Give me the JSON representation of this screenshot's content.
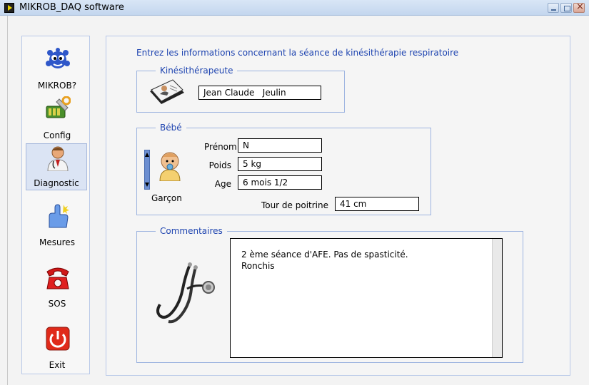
{
  "window": {
    "title": "MIKROB_DAQ software"
  },
  "sidebar": {
    "items": [
      {
        "label": "MIKROB?",
        "icon": "mikrob-creature-icon",
        "active": false
      },
      {
        "label": "Config",
        "icon": "config-tools-icon",
        "active": false
      },
      {
        "label": "Diagnostic",
        "icon": "doctor-icon",
        "active": true
      },
      {
        "label": "Mesures",
        "icon": "pointing-hand-icon",
        "active": false
      },
      {
        "label": "SOS",
        "icon": "red-phone-icon",
        "active": false
      },
      {
        "label": "Exit",
        "icon": "power-icon",
        "active": false
      }
    ]
  },
  "main": {
    "intro": "Entrez les informations concernant la séance de kinésithérapie respiratoire",
    "kine": {
      "title": "Kinésithérapeute",
      "name_value": "Jean Claude   Jeulin"
    },
    "bebe": {
      "title": "Bébé",
      "prenom_label": "Prénom",
      "prenom_value": "N",
      "poids_label": "Poids",
      "poids_value": "5 kg",
      "age_label": "Age",
      "age_value": "6 mois 1/2",
      "sexe_value": "Garçon",
      "tour_label": "Tour de poitrine",
      "tour_value": "41 cm"
    },
    "comments": {
      "title": "Commentaires",
      "text": "2 ème séance d'AFE. Pas de spasticité.\nRonchis"
    }
  },
  "colors": {
    "accent_blue": "#1e44b0",
    "group_border": "#9db4e0",
    "active_nav_bg": "#dbe4f4"
  }
}
